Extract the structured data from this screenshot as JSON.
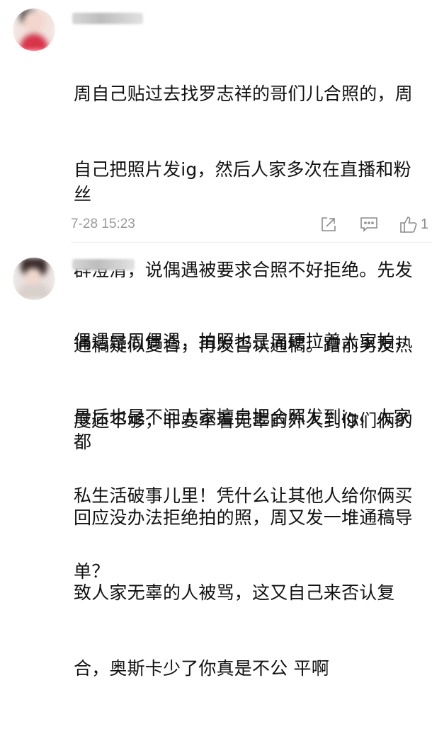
{
  "comments": [
    {
      "username": "",
      "body_lines": [
        "周自己贴过去找罗志祥的哥们儿合照的，周",
        "自己把照片发ig，然后人家多次在直播和粉丝",
        "群澄清，说偶遇被要求合照不好拒绝。先发",
        "通稿疑似复合，再发否认通稿。蹭前男友热",
        "度还不够，非要牵着无辜的外人到你们俩的",
        "私生活破事儿里！凭什么让其他人给你俩买",
        "单？"
      ],
      "timestamp": "7-28 15:23",
      "like_count": "1",
      "icons": {
        "share": "share-icon",
        "reply": "comment-icon",
        "like": "thumbs-up-icon"
      }
    },
    {
      "username": "",
      "body_lines": [
        "偶遇是周偶遇，拍照也是周硬拉着人家拍，",
        "最后也是不问人家擅自把合照发到ig，人家都",
        "回应没办法拒绝拍的照，周又发一堆通稿导",
        "致人家无辜的人被骂，这又自己来否认复",
        "合，奥斯卡少了你真是不公 平啊"
      ]
    }
  ],
  "colors": {
    "text": "#111111",
    "meta": "#9a9a9a",
    "icon": "#8c8c8c"
  }
}
